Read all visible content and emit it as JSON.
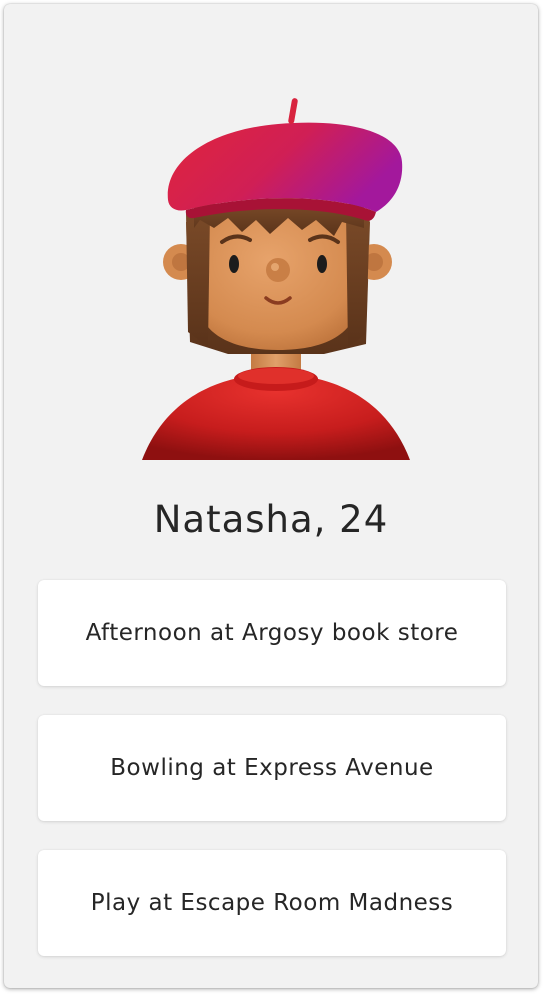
{
  "profile": {
    "name_age": "Natasha, 24",
    "avatar_icon": "avatar-woman-beret-icon"
  },
  "options": [
    {
      "label": "Afternoon at Argosy book store"
    },
    {
      "label": "Bowling at Express Avenue"
    },
    {
      "label": "Play at Escape Room Madness"
    }
  ],
  "colors": {
    "card_background": "#f2f2f2",
    "option_background": "#ffffff",
    "text": "#262626",
    "beret": "#d81b3a",
    "sweater": "#cc1f1f",
    "skin": "#d99058",
    "hair": "#6b3f22"
  }
}
